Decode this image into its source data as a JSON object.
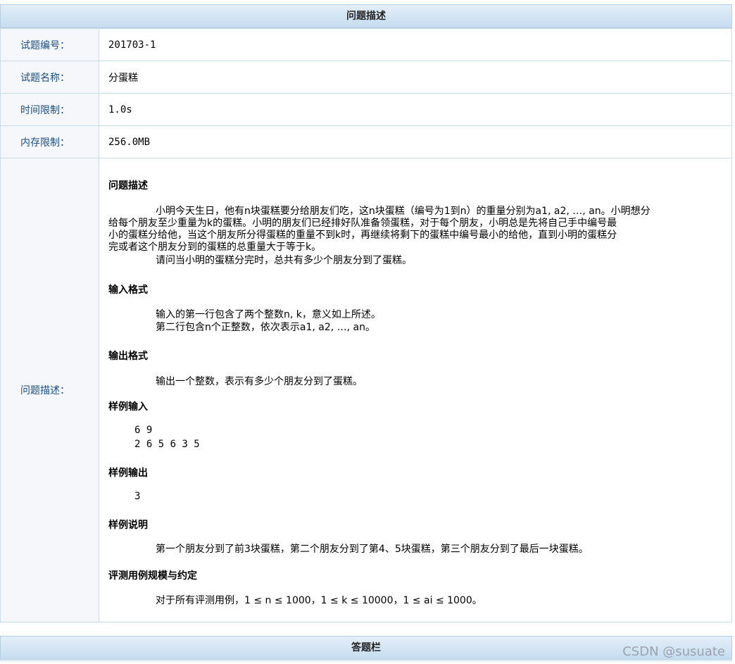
{
  "header": {
    "title": "问题描述"
  },
  "rows": [
    {
      "label": "试题编号：",
      "value": "201703-1"
    },
    {
      "label": "试题名称：",
      "value": "分蛋糕"
    },
    {
      "label": "时间限制：",
      "value": "1.0s"
    },
    {
      "label": "内存限制：",
      "value": "256.0MB"
    }
  ],
  "desc_label": "问题描述：",
  "sections": {
    "problem": "问题描述",
    "input": "输入格式",
    "output": "输出格式",
    "sample_in": "样例输入",
    "sample_out": "样例输出",
    "sample_explain": "样例说明",
    "scale": "评测用例规模与约定"
  },
  "problem_lines": [
    "小明今天生日，他有n块蛋糕要分给朋友们吃，这n块蛋糕（编号为1到n）的重量分别为a1, a2, …, an。小明想分",
    "给每个朋友至少重量为k的蛋糕。小明的朋友们已经排好队准备领蛋糕，对于每个朋友，小明总是先将自己手中编号最",
    "小的蛋糕分给他，当这个朋友所分得蛋糕的重量不到k时，再继续将剩下的蛋糕中编号最小的给他，直到小明的蛋糕分",
    "完或者这个朋友分到的蛋糕的总重量大于等于k。",
    "请问当小明的蛋糕分完时，总共有多少个朋友分到了蛋糕。"
  ],
  "input_lines": [
    "输入的第一行包含了两个整数n, k，意义如上所述。",
    "第二行包含n个正整数，依次表示a1, a2, …, an。"
  ],
  "output_line": "输出一个整数，表示有多少个朋友分到了蛋糕。",
  "sample_input": "6 9\n2 6 5 6 3 5",
  "sample_output": "3",
  "sample_explain_line": "第一个朋友分到了前3块蛋糕，第二个朋友分到了第4、5块蛋糕，第三个朋友分到了最后一块蛋糕。",
  "scale_line": "对于所有评测用例，1 ≤ n ≤ 1000，1 ≤ k ≤ 10000，1 ≤ ai ≤ 1000。",
  "footer": {
    "title": "答题栏"
  },
  "watermark": "CSDN @susuate"
}
